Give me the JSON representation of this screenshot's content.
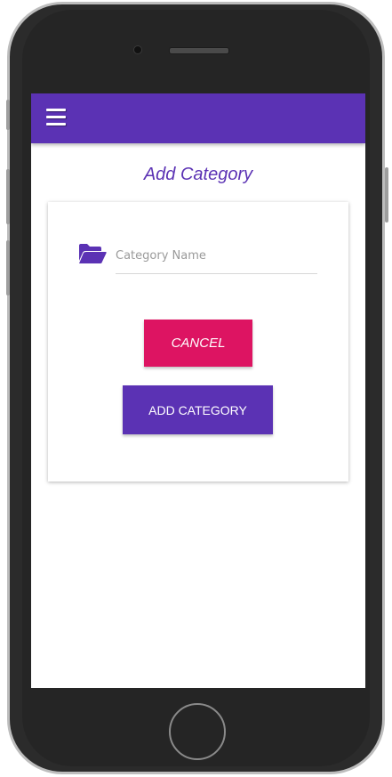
{
  "colors": {
    "primary": "#5b32b4",
    "cancel": "#dd1462",
    "appbar": "#5b32b4"
  },
  "appbar": {
    "menu_icon": "hamburger-menu-icon"
  },
  "page": {
    "title": "Add Category"
  },
  "form": {
    "field_icon": "folder-open-icon",
    "category_name_placeholder": "Category Name",
    "category_name_value": ""
  },
  "buttons": {
    "cancel_label": "CANCEL",
    "add_label": "ADD CATEGORY"
  }
}
